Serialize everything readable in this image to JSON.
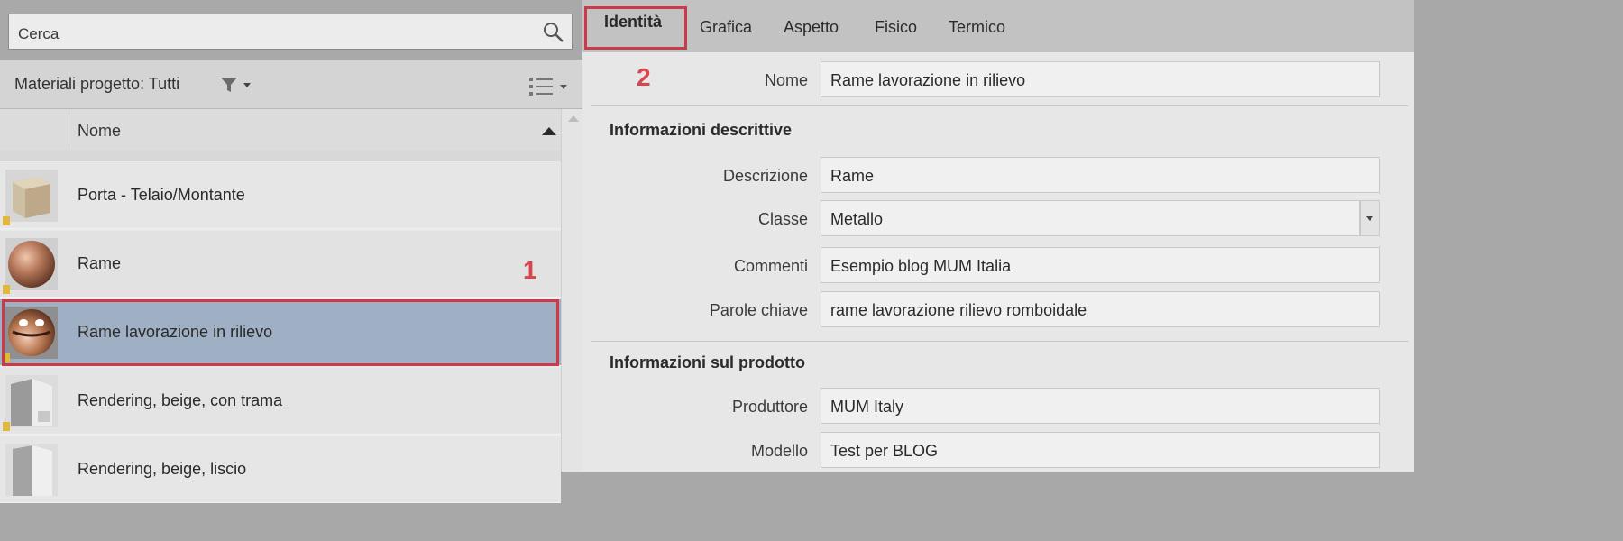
{
  "search": {
    "placeholder": "Cerca"
  },
  "filter": {
    "label": "Materiali progetto: Tutti"
  },
  "list": {
    "column_header": "Nome",
    "rows": [
      {
        "label": "Porta - Telaio/Montante",
        "thumb": "beige-cube"
      },
      {
        "label": "Rame",
        "thumb": "copper-sphere"
      },
      {
        "label": "Rame lavorazione in rilievo",
        "thumb": "copper-embossed-sphere",
        "selected": true
      },
      {
        "label": "Rendering, beige, con trama",
        "thumb": "beige-textured-shape"
      },
      {
        "label": "Rendering, beige, liscio",
        "thumb": "beige-smooth-shape"
      }
    ]
  },
  "annotations": {
    "marker1": "1",
    "marker2": "2",
    "highlight_color": "#cc3a4a"
  },
  "tabs": [
    "Identità",
    "Grafica",
    "Aspetto",
    "Fisico",
    "Termico"
  ],
  "identity": {
    "name_label": "Nome",
    "name_value": "Rame lavorazione in rilievo",
    "section_descriptive": "Informazioni descrittive",
    "descrizione_label": "Descrizione",
    "descrizione_value": "Rame",
    "classe_label": "Classe",
    "classe_value": "Metallo",
    "commenti_label": "Commenti",
    "commenti_value": "Esempio blog MUM Italia",
    "parole_label": "Parole chiave",
    "parole_value": "rame lavorazione rilievo romboidale",
    "section_product": "Informazioni sul prodotto",
    "produttore_label": "Produttore",
    "produttore_value": "MUM Italy",
    "modello_label": "Modello",
    "modello_value": "Test per BLOG"
  }
}
